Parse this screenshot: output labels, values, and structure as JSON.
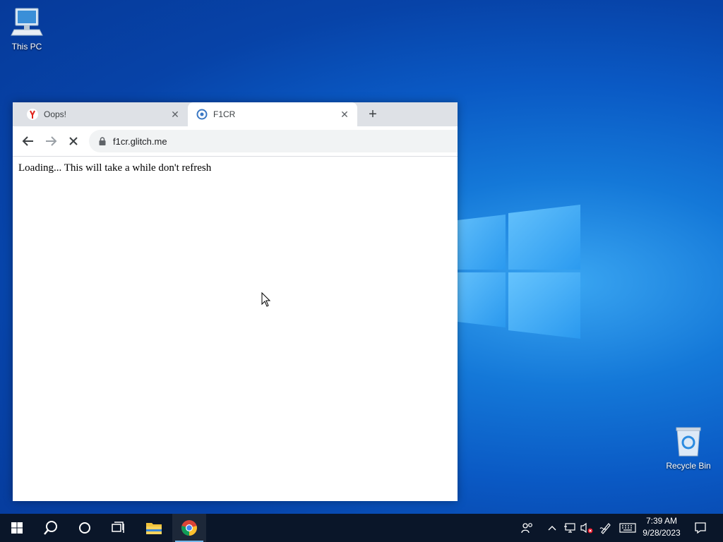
{
  "desktop": {
    "icons": [
      {
        "label": "This PC",
        "icon": "computer-icon"
      },
      {
        "label": "Recycle Bin",
        "icon": "recycle-bin-icon"
      }
    ]
  },
  "browser": {
    "tabs": [
      {
        "title": "Oops!",
        "icon": "yandex-icon",
        "active": false
      },
      {
        "title": "F1CR",
        "icon": "site-favicon-icon",
        "active": true
      }
    ],
    "new_tab_label": "+",
    "address": "f1cr.glitch.me",
    "page_text": "Loading... This will take a while don't refresh"
  },
  "taskbar": {
    "clock_time": "7:39 AM",
    "clock_date": "9/28/2023"
  },
  "colors": {
    "accent": "#76b9ed",
    "taskbar_bg": "#0a1629",
    "tabstrip_bg": "#dee1e6"
  }
}
